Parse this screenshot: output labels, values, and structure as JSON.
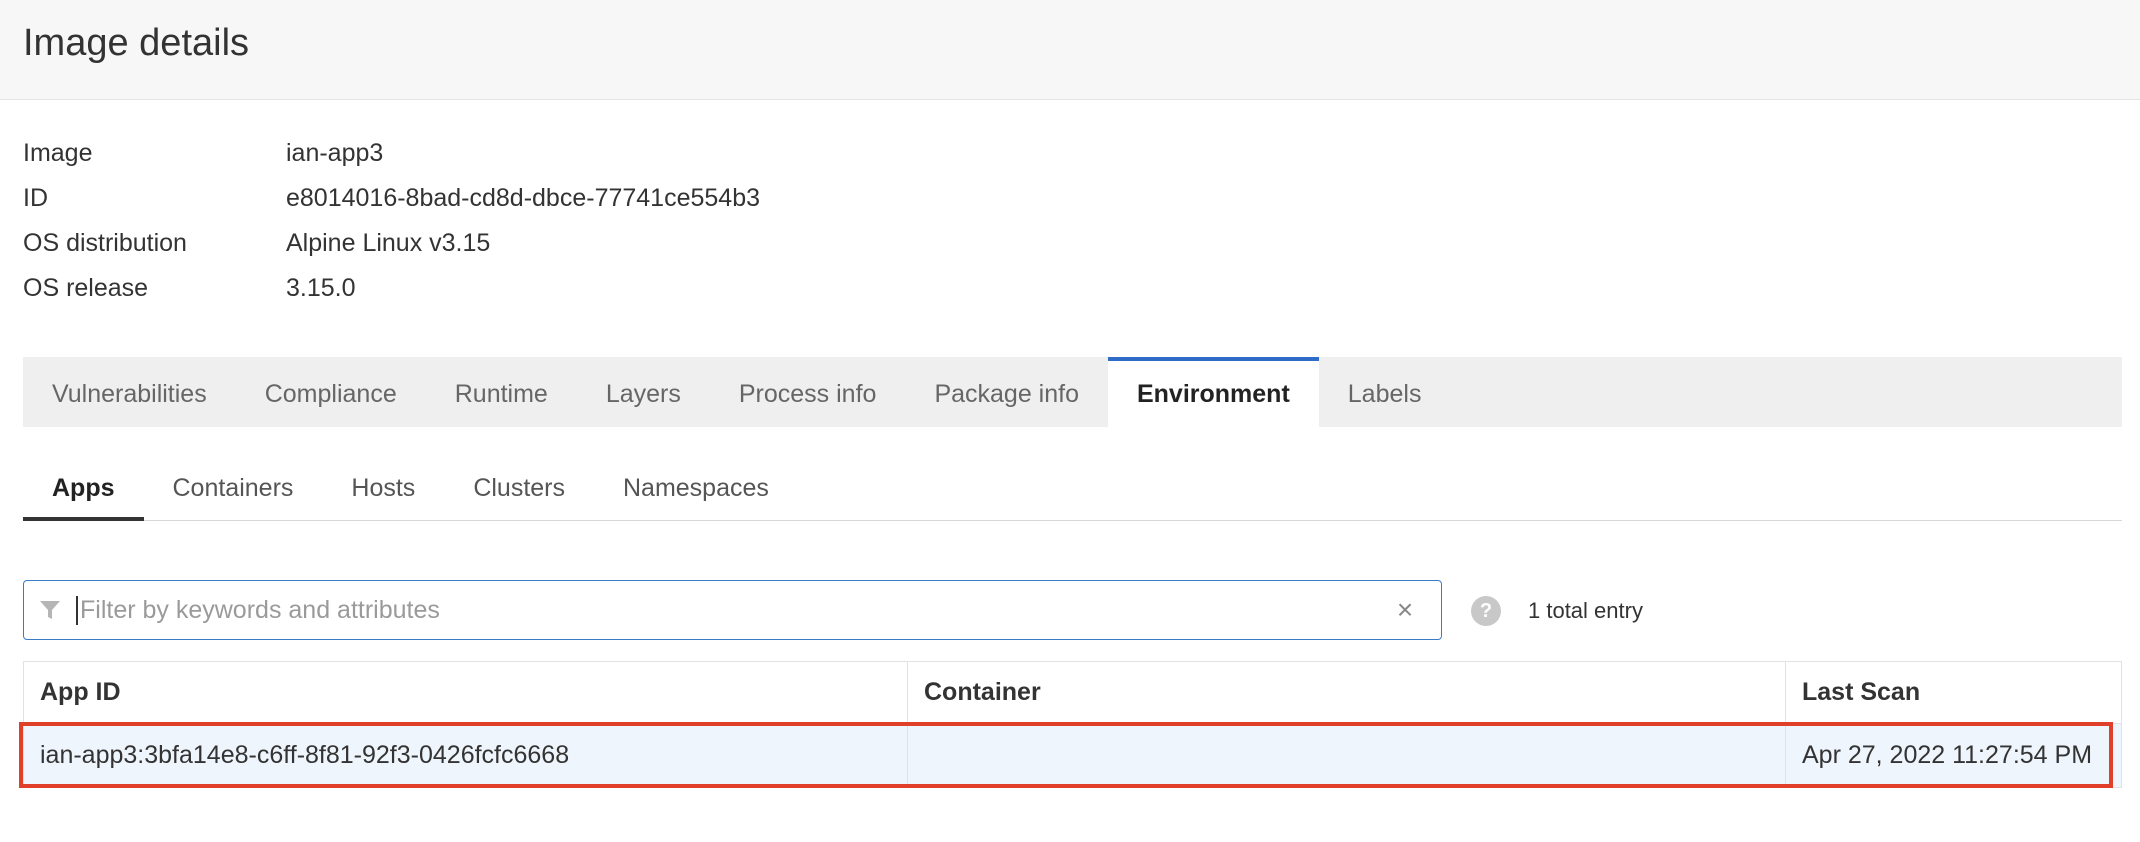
{
  "page": {
    "title": "Image details"
  },
  "details": [
    {
      "label": "Image",
      "value": "ian-app3"
    },
    {
      "label": "ID",
      "value": "e8014016-8bad-cd8d-dbce-77741ce554b3"
    },
    {
      "label": "OS distribution",
      "value": "Alpine Linux v3.15"
    },
    {
      "label": "OS release",
      "value": "3.15.0"
    }
  ],
  "tabs": [
    {
      "label": "Vulnerabilities"
    },
    {
      "label": "Compliance"
    },
    {
      "label": "Runtime"
    },
    {
      "label": "Layers"
    },
    {
      "label": "Process info"
    },
    {
      "label": "Package info"
    },
    {
      "label": "Environment",
      "active": true
    },
    {
      "label": "Labels"
    }
  ],
  "subtabs": [
    {
      "label": "Apps",
      "active": true
    },
    {
      "label": "Containers"
    },
    {
      "label": "Hosts"
    },
    {
      "label": "Clusters"
    },
    {
      "label": "Namespaces"
    }
  ],
  "filter": {
    "placeholder": "Filter by keywords and attributes",
    "value": "",
    "icon": "filter-icon",
    "clear_icon": "close-icon"
  },
  "help": {
    "icon_glyph": "?"
  },
  "total_entries": "1 total entry",
  "table": {
    "columns": [
      "App ID",
      "Container",
      "Last Scan"
    ],
    "rows": [
      {
        "app_id": "ian-app3:3bfa14e8-c6ff-8f81-92f3-0426fcfc6668",
        "container": "",
        "last_scan": "Apr 27, 2022 11:27:54 PM"
      }
    ]
  },
  "colors": {
    "accent": "#2f6cc7",
    "highlight": "#e0402a",
    "row_bg": "#eff5fc"
  }
}
